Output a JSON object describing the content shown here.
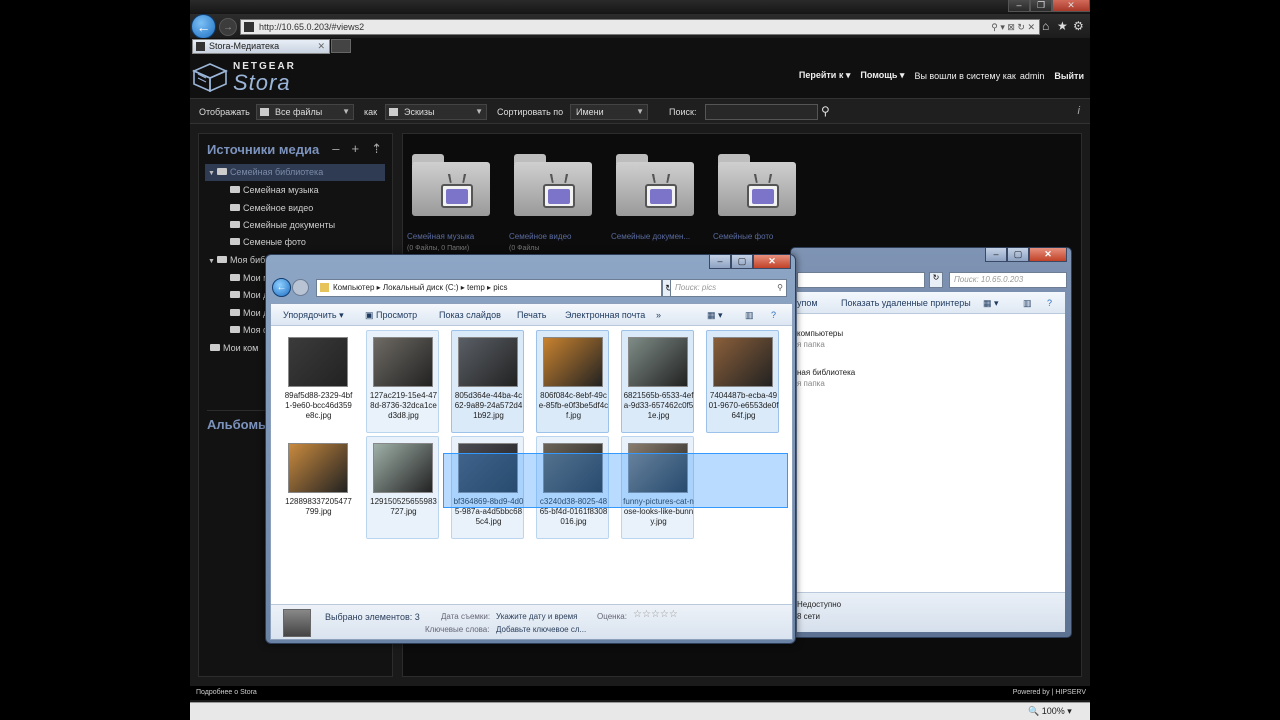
{
  "browser": {
    "url": "http://10.65.0.203/#views2",
    "tab_title": "Stora-Медиатека",
    "window_controls": [
      "minimize",
      "maximize",
      "close"
    ],
    "nav_icons": [
      "home-icon",
      "star-icon",
      "gear-icon"
    ]
  },
  "header": {
    "brand_top": "NETGEAR",
    "brand_bottom": "Stora",
    "menu": {
      "goto": "Перейти к",
      "help": "Помощь",
      "logged_in": "Вы вошли в систему как",
      "username": "admin",
      "logout": "Выйти"
    }
  },
  "filterbar": {
    "show_label": "Отображать",
    "show_value": "Все файлы",
    "as_label": "как",
    "as_value": "Эскизы",
    "sort_label": "Сортировать по",
    "sort_value": "Имени",
    "search_label": "Поиск:",
    "search_value": ""
  },
  "sidebar": {
    "title": "Источники медиа",
    "albums_title": "Альбомы",
    "items": [
      {
        "label": "Семейная библиотека",
        "level": 0,
        "expanded": true,
        "selected": true
      },
      {
        "label": "Семейная музыка",
        "level": 1
      },
      {
        "label": "Семейное видео",
        "level": 1
      },
      {
        "label": "Семейные документы",
        "level": 1
      },
      {
        "label": "Семеные фото",
        "level": 1
      },
      {
        "label": "Моя библ",
        "level": 0,
        "expanded": true
      },
      {
        "label": "Мои м",
        "level": 1
      },
      {
        "label": "Мои д",
        "level": 1
      },
      {
        "label": "Мои д",
        "level": 1
      },
      {
        "label": "Моя ф",
        "level": 1
      },
      {
        "label": "Мои ком",
        "level": 0
      }
    ]
  },
  "main": {
    "folders": [
      {
        "label": "Семейная музыка",
        "sub": "(0 Файлы, 0 Папки)"
      },
      {
        "label": "Семейное видео",
        "sub": "(0 Файлы"
      },
      {
        "label": "Семейные докумен...",
        "sub": ""
      },
      {
        "label": "Семейные фото",
        "sub": ""
      }
    ]
  },
  "explorer": {
    "breadcrumb": "Компьютер  ▸  Локальный диск (C:)  ▸  temp  ▸  pics",
    "search_placeholder": "Поиск: pics",
    "toolbar": {
      "organize": "Упорядочить",
      "preview": "Просмотр",
      "slideshow": "Показ слайдов",
      "print": "Печать",
      "email": "Электронная почта",
      "more": "»"
    },
    "files": [
      {
        "name": "89af5d88-2329-4bf1-9e60-bcc46d359e8c.jpg",
        "state": "normal",
        "thumb": "#3b3b3b"
      },
      {
        "name": "127ac219-15e4-478d-8736-32dca1ced3d8.jpg",
        "state": "hover",
        "thumb": "#6e6a64"
      },
      {
        "name": "805d364e-44ba-4c62-9a89-24a572d41b92.jpg",
        "state": "selected",
        "thumb": "#5a5f66"
      },
      {
        "name": "806f084c-8ebf-49ce-85fb-e0f3be5df4cf.jpg",
        "state": "selected",
        "thumb": "#c8822f"
      },
      {
        "name": "6821565b-6533-4efa-9d33-657462c0f51e.jpg",
        "state": "selected",
        "thumb": "#7e8c86"
      },
      {
        "name": "7404487b-ecba-4901-9670-e6553de0f64f.jpg",
        "state": "selected",
        "thumb": "#8a5f3a"
      },
      {
        "name": "128898337205477799.jpg",
        "state": "normal",
        "thumb": "#c98a3e"
      },
      {
        "name": "129150525655983727.jpg",
        "state": "hover",
        "thumb": "#9fb0a8"
      },
      {
        "name": "bf364869-8bd9-4d05-987a-a4d5bbc685c4.jpg",
        "state": "hover",
        "thumb": "#4a4a52"
      },
      {
        "name": "c3240d38-8025-4865-bf4d-0161f8308016.jpg",
        "state": "hover",
        "thumb": "#6b6357"
      },
      {
        "name": "funny-pictures-cat-nose-looks-like-bunny.jpg",
        "state": "hover",
        "thumb": "#8a7d6d"
      }
    ],
    "details": {
      "selected": "Выбрано элементов: 3",
      "date_label": "Дата съемки:",
      "date_value": "Укажите дату и время",
      "rating_label": "Оценка:",
      "keywords_label": "Ключевые слова:",
      "keywords_value": "Добавьте ключевое сл..."
    }
  },
  "explorer_back": {
    "search_placeholder": "Поиск: 10.65.0.203",
    "toolbar_group": "упом",
    "toolbar_printers": "Показать удаленные принтеры",
    "lines": [
      "компьютеры",
      "я папка",
      "ная библиотека",
      "я папка"
    ],
    "bottom": [
      "Недоступно",
      "8 сети"
    ]
  },
  "footer": {
    "about": "Подробнее о Stora",
    "powered": "Powered by | HIPSERV"
  },
  "status": {
    "zoom": "100%"
  },
  "colors": {
    "accent": "#7c93bd",
    "selection": "#3399ff"
  }
}
